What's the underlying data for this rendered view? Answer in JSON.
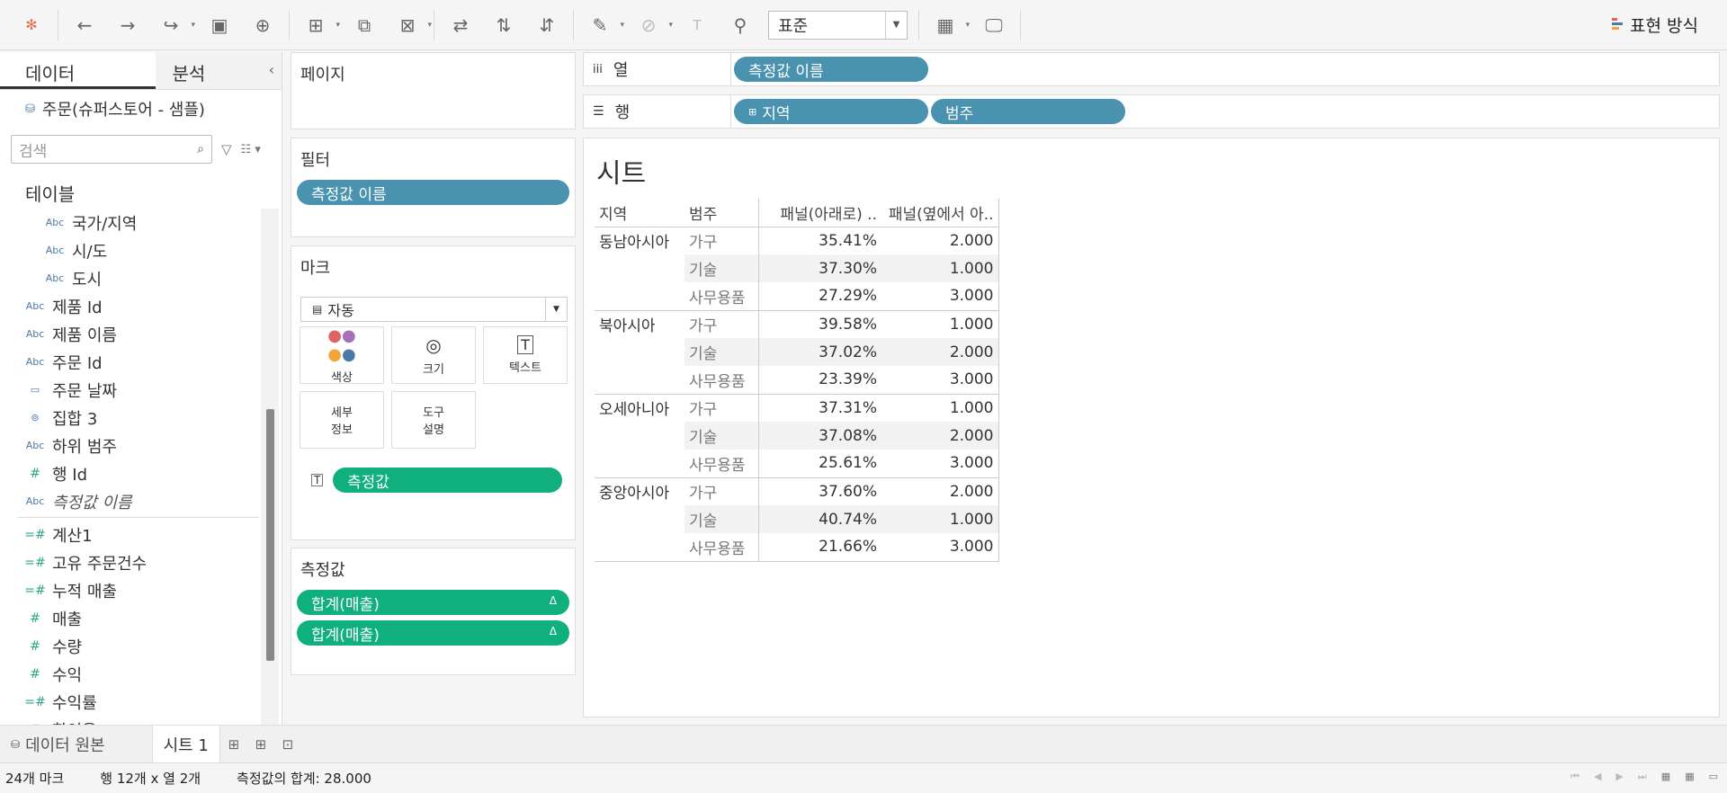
{
  "toolbar": {
    "fit_select": "표준",
    "show_me": "표현 방식",
    "show_me_colors": [
      "#e06262",
      "#4a7aa8",
      "#f2a33a"
    ]
  },
  "left": {
    "tab_data": "데이터",
    "tab_analysis": "분석",
    "datasource": "주문(슈퍼스토어 - 샘플)",
    "search_placeholder": "검색",
    "tables_title": "테이블",
    "fields": [
      {
        "label": "국가/지역",
        "type": "Abc",
        "level": "sub"
      },
      {
        "label": "시/도",
        "type": "Abc",
        "level": "sub"
      },
      {
        "label": "도시",
        "type": "Abc",
        "level": "sub"
      },
      {
        "label": "제품 Id",
        "type": "Abc",
        "level": "top"
      },
      {
        "label": "제품 이름",
        "type": "Abc",
        "level": "top"
      },
      {
        "label": "주문 Id",
        "type": "Abc",
        "level": "top"
      },
      {
        "label": "주문 날짜",
        "type": "date",
        "level": "top"
      },
      {
        "label": "집합 3",
        "type": "set",
        "level": "top"
      },
      {
        "label": "하위 범주",
        "type": "Abc",
        "level": "top"
      },
      {
        "label": "행 Id",
        "type": "#",
        "level": "top"
      },
      {
        "label": "측정값 이름",
        "type": "Abc",
        "level": "top",
        "italic": true
      },
      {
        "label": "계산1",
        "type": "=#",
        "level": "top"
      },
      {
        "label": "고유 주문건수",
        "type": "=#",
        "level": "top"
      },
      {
        "label": "누적 매출",
        "type": "=#",
        "level": "top"
      },
      {
        "label": "매출",
        "type": "#",
        "level": "top"
      },
      {
        "label": "수량",
        "type": "#",
        "level": "top"
      },
      {
        "label": "수익",
        "type": "#",
        "level": "top"
      },
      {
        "label": "수익률",
        "type": "=#",
        "level": "top"
      },
      {
        "label": "할인율",
        "type": "#",
        "level": "top"
      }
    ]
  },
  "cards": {
    "pages_title": "페이지",
    "filters_title": "필터",
    "filter_pill": "측정값 이름",
    "marks_title": "마크",
    "marks_type": "자동",
    "mark_color": "색상",
    "mark_size": "크기",
    "mark_text": "텍스트",
    "mark_detail": "세부\n정보",
    "mark_tooltip": "도구\n설명",
    "text_pill": "측정값",
    "measures_title": "측정값",
    "measure_pills": [
      "합계(매출)",
      "합계(매출)"
    ]
  },
  "shelves": {
    "columns_label": "열",
    "columns_pill": "측정값 이름",
    "rows_label": "행",
    "rows_pills": [
      "지역",
      "범주"
    ]
  },
  "view": {
    "title": "시트",
    "headers": [
      "지역",
      "범주",
      "패널(아래로) ..",
      "패널(옆에서 아.."
    ],
    "rows": [
      {
        "region": "동남아시아",
        "category": "가구",
        "v1": "35.41%",
        "v2": "2.000"
      },
      {
        "region": "",
        "category": "기술",
        "v1": "37.30%",
        "v2": "1.000"
      },
      {
        "region": "",
        "category": "사무용품",
        "v1": "27.29%",
        "v2": "3.000"
      },
      {
        "region": "북아시아",
        "category": "가구",
        "v1": "39.58%",
        "v2": "1.000"
      },
      {
        "region": "",
        "category": "기술",
        "v1": "37.02%",
        "v2": "2.000"
      },
      {
        "region": "",
        "category": "사무용품",
        "v1": "23.39%",
        "v2": "3.000"
      },
      {
        "region": "오세아니아",
        "category": "가구",
        "v1": "37.31%",
        "v2": "1.000"
      },
      {
        "region": "",
        "category": "기술",
        "v1": "37.08%",
        "v2": "2.000"
      },
      {
        "region": "",
        "category": "사무용품",
        "v1": "25.61%",
        "v2": "3.000"
      },
      {
        "region": "중앙아시아",
        "category": "가구",
        "v1": "37.60%",
        "v2": "2.000"
      },
      {
        "region": "",
        "category": "기술",
        "v1": "40.74%",
        "v2": "1.000"
      },
      {
        "region": "",
        "category": "사무용품",
        "v1": "21.66%",
        "v2": "3.000"
      }
    ]
  },
  "tabs": {
    "datasource_tab": "데이터 원본",
    "sheet_tab": "시트 1"
  },
  "status": {
    "marks": "24개 마크",
    "rows_cols": "행 12개 x 열 2개",
    "sum": "측정값의 합계: 28.000"
  }
}
